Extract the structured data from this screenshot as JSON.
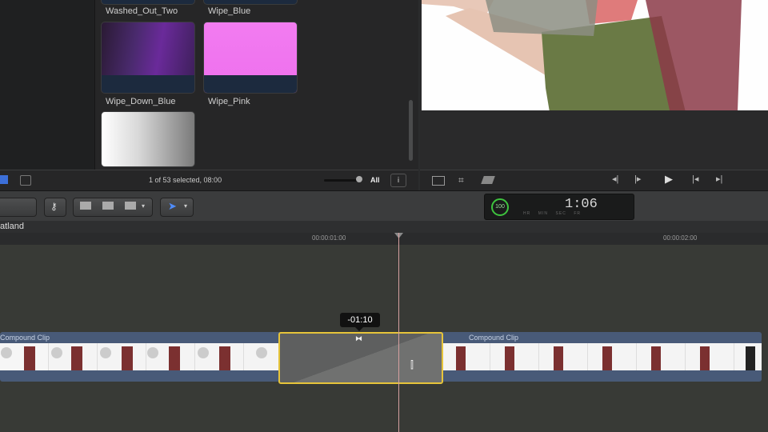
{
  "browser": {
    "clips": [
      {
        "label": "Washed_Out_Two"
      },
      {
        "label": "Wipe_Blue"
      },
      {
        "label": "Wipe_Down_Blue"
      },
      {
        "label": "Wipe_Pink"
      },
      {
        "label": "",
        "note_visible": false
      }
    ],
    "status": "1 of 53 selected, 08:00",
    "filter": "All"
  },
  "toolbar": {
    "timecode": "1:06",
    "timecode_sub": [
      "HR",
      "MIN",
      "SEC",
      "FR"
    ],
    "percent": "100"
  },
  "timeline": {
    "project_name": "atland",
    "ruler_ticks": [
      "00:00:01:00",
      "00:00:02:00"
    ],
    "left_clip_name": "Compound Clip",
    "right_clip_name": "Compound Clip",
    "tooltip": "-01:10"
  },
  "colors": {
    "accent_yellow": "#e6c43a",
    "storyline_blue": "#485a78",
    "timecode_green": "#3ec43e"
  }
}
